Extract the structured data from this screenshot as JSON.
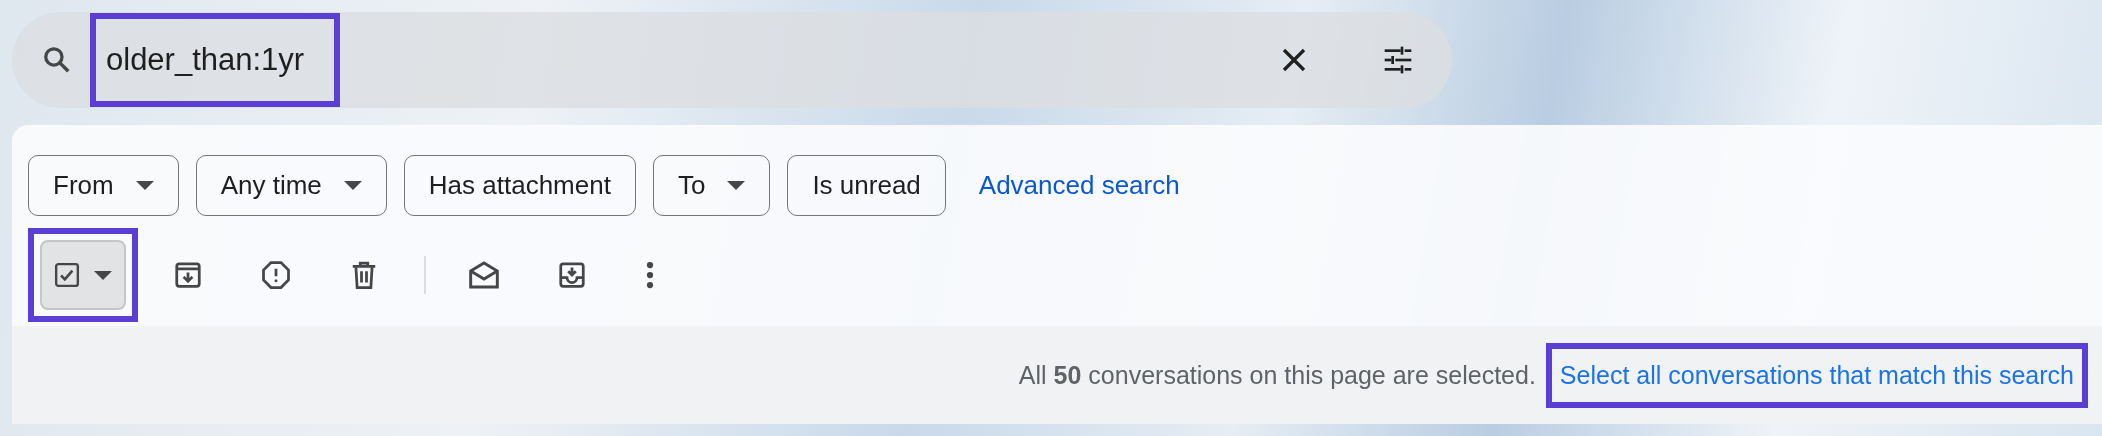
{
  "search": {
    "value": "older_than:1yr",
    "highlighted": true
  },
  "filters": [
    {
      "label": "From",
      "kind": "dropdown"
    },
    {
      "label": "Any time",
      "kind": "dropdown"
    },
    {
      "label": "Has attachment",
      "kind": "toggle"
    },
    {
      "label": "To",
      "kind": "dropdown"
    },
    {
      "label": "Is unread",
      "kind": "toggle"
    }
  ],
  "advanced_search": "Advanced search",
  "toolbar": {
    "select_all_checked": true,
    "select_highlighted": true
  },
  "selection_banner": {
    "message": "All **50** conversations on this page are selected.",
    "link": "Select all conversations that match this search",
    "link_highlighted": true
  }
}
